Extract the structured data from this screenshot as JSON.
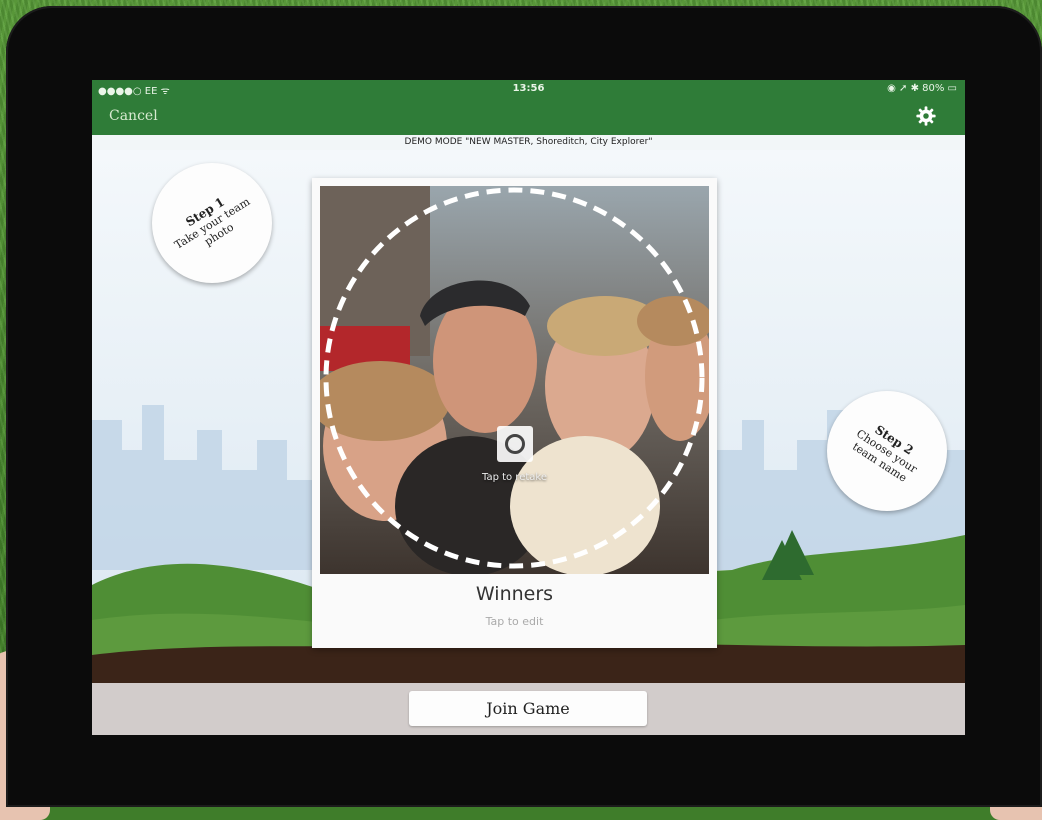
{
  "status_bar": {
    "carrier": "●●●●○ EE ᯤ",
    "time": "13:56",
    "right": "◉ ➚ ✱ 80% ▭"
  },
  "nav": {
    "cancel_label": "Cancel",
    "settings_icon": "gear-icon"
  },
  "demo_banner": "DEMO MODE \"NEW MASTER, Shoreditch, City Explorer\"",
  "steps": [
    {
      "title": "Step 1",
      "text": "Take your team photo"
    },
    {
      "title": "Step 2",
      "text": "Choose your team name"
    }
  ],
  "photo_card": {
    "retake_label": "Tap to retake",
    "camera_icon": "camera-icon",
    "team_name": "Winners",
    "edit_hint": "Tap to edit"
  },
  "footer": {
    "join_label": "Join Game"
  },
  "colors": {
    "brand_green": "#2f7c38",
    "hill_green": "#4f8e35",
    "footer_gray": "#d2cccb"
  }
}
